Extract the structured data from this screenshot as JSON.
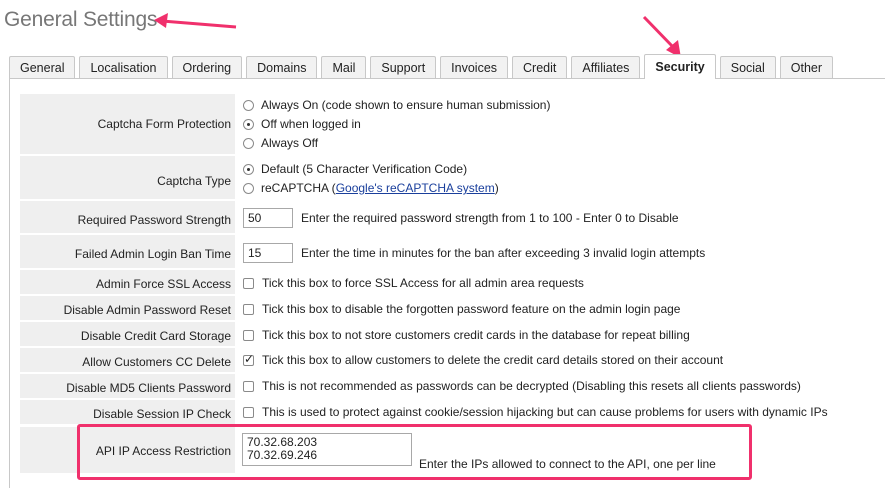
{
  "page": {
    "title": "General Settings"
  },
  "tabs": [
    {
      "label": "General"
    },
    {
      "label": "Localisation"
    },
    {
      "label": "Ordering"
    },
    {
      "label": "Domains"
    },
    {
      "label": "Mail"
    },
    {
      "label": "Support"
    },
    {
      "label": "Invoices"
    },
    {
      "label": "Credit"
    },
    {
      "label": "Affiliates"
    },
    {
      "label": "Security",
      "active": true
    },
    {
      "label": "Social"
    },
    {
      "label": "Other"
    }
  ],
  "settings": {
    "captcha_protection": {
      "label": "Captcha Form Protection",
      "options": [
        {
          "label": "Always On (code shown to ensure human submission)",
          "selected": false
        },
        {
          "label": "Off when logged in",
          "selected": true
        },
        {
          "label": "Always Off",
          "selected": false
        }
      ]
    },
    "captcha_type": {
      "label": "Captcha Type",
      "options": [
        {
          "label": "Default (5 Character Verification Code)",
          "selected": true
        },
        {
          "label": "reCAPTCHA (",
          "link": "Google's reCAPTCHA system",
          "suffix": ")",
          "selected": false
        }
      ]
    },
    "password_strength": {
      "label": "Required Password Strength",
      "value": "50",
      "help": "Enter the required password strength from 1 to 100 - Enter 0 to Disable"
    },
    "ban_time": {
      "label": "Failed Admin Login Ban Time",
      "value": "15",
      "help": "Enter the time in minutes for the ban after exceeding 3 invalid login attempts"
    },
    "force_ssl": {
      "label": "Admin Force SSL Access",
      "checked": false,
      "help": "Tick this box to force SSL Access for all admin area requests"
    },
    "disable_pw_reset": {
      "label": "Disable Admin Password Reset",
      "checked": false,
      "help": "Tick this box to disable the forgotten password feature on the admin login page"
    },
    "disable_cc_storage": {
      "label": "Disable Credit Card Storage",
      "checked": false,
      "help": "Tick this box to not store customers credit cards in the database for repeat billing"
    },
    "allow_cc_delete": {
      "label": "Allow Customers CC Delete",
      "checked": true,
      "help": "Tick this box to allow customers to delete the credit card details stored on their account"
    },
    "disable_md5": {
      "label": "Disable MD5 Clients Password",
      "checked": false,
      "help": "This is not recommended as passwords can be decrypted (Disabling this resets all clients passwords)"
    },
    "disable_session_ip": {
      "label": "Disable Session IP Check",
      "checked": false,
      "help": "This is used to protect against cookie/session hijacking but can cause problems for users with dynamic IPs"
    },
    "api_ip": {
      "label": "API IP Access Restriction",
      "value": "70.32.68.203\n70.32.69.246",
      "help": "Enter the IPs allowed to connect to the API, one per line"
    }
  },
  "annotation": {
    "color": "#f0306c"
  }
}
